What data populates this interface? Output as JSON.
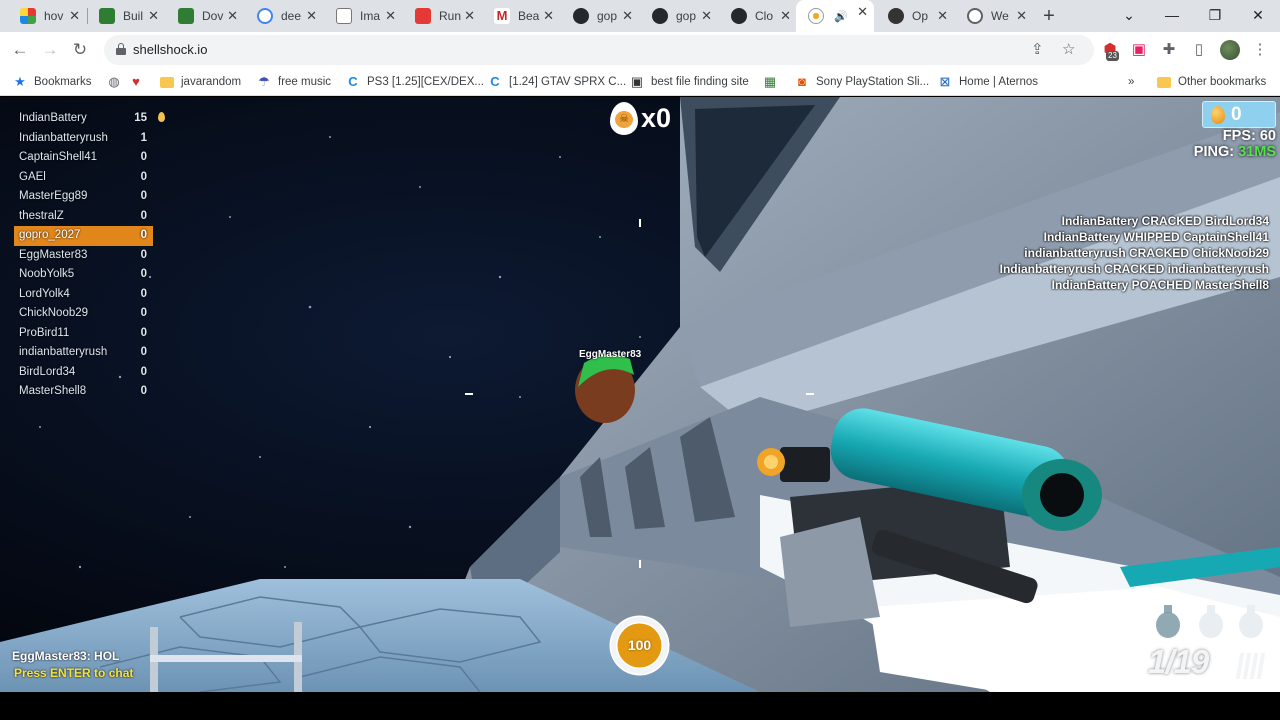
{
  "browser": {
    "tabs": [
      {
        "label": "hov",
        "active": false
      },
      {
        "label": "Buil",
        "active": false
      },
      {
        "label": "Dov",
        "active": false
      },
      {
        "label": "dee",
        "active": false
      },
      {
        "label": "Ima",
        "active": false
      },
      {
        "label": "Run",
        "active": false
      },
      {
        "label": "Bea",
        "active": false
      },
      {
        "label": "gop",
        "active": false
      },
      {
        "label": "gop",
        "active": false
      },
      {
        "label": "Clo",
        "active": false
      },
      {
        "label": "",
        "active": true
      },
      {
        "label": "Op",
        "active": false
      },
      {
        "label": "We",
        "active": false
      }
    ],
    "new_tab_icon": "+",
    "url": "shellshock.io",
    "extension_badge": "23",
    "bookmarks": [
      {
        "label": "Bookmarks",
        "icon": "star-icon"
      },
      {
        "label": "",
        "icon": "globe-icon"
      },
      {
        "label": "",
        "icon": "heart-icon"
      },
      {
        "label": "javarandom",
        "icon": "folder-icon"
      },
      {
        "label": "free music",
        "icon": "parachute-icon"
      },
      {
        "label": "PS3 [1.25][CEX/DEX...",
        "icon": "c-logo-icon"
      },
      {
        "label": "[1.24] GTAV SPRX C...",
        "icon": "c-logo-icon"
      },
      {
        "label": "best file finding site",
        "icon": "robot-icon"
      },
      {
        "label": "",
        "icon": "game-icon"
      },
      {
        "label": "Sony PlayStation Sli...",
        "icon": "bag-icon"
      },
      {
        "label": "Home | Aternos",
        "icon": "aternos-icon"
      }
    ],
    "other_bookmarks": "Other bookmarks",
    "overflow": "»"
  },
  "game": {
    "leaderboard": [
      {
        "name": "IndianBattery",
        "score": "15",
        "self": false,
        "egg": true
      },
      {
        "name": "Indianbatteryrush",
        "score": "1",
        "self": false
      },
      {
        "name": "CaptainShell41",
        "score": "0",
        "self": false
      },
      {
        "name": "GAEl",
        "score": "0",
        "self": false
      },
      {
        "name": "MasterEgg89",
        "score": "0",
        "self": false
      },
      {
        "name": "thestralZ",
        "score": "0",
        "self": false
      },
      {
        "name": "gopro_2027",
        "score": "0",
        "self": true
      },
      {
        "name": "EggMaster83",
        "score": "0",
        "self": false
      },
      {
        "name": "NoobYolk5",
        "score": "0",
        "self": false
      },
      {
        "name": "LordYolk4",
        "score": "0",
        "self": false
      },
      {
        "name": "ChickNoob29",
        "score": "0",
        "self": false
      },
      {
        "name": "ProBird11",
        "score": "0",
        "self": false
      },
      {
        "name": "indianbatteryrush",
        "score": "0",
        "self": false
      },
      {
        "name": "BirdLord34",
        "score": "0",
        "self": false
      },
      {
        "name": "MasterShell8",
        "score": "0",
        "self": false
      }
    ],
    "streak": "x0",
    "eggs": "0",
    "fps_label": "FPS:",
    "fps": "60",
    "ping_label": "PING:",
    "ping": "31MS",
    "killfeed": [
      "IndianBattery CRACKED BirdLord34",
      "IndianBattery WHIPPED CaptainShell41",
      "indianbatteryrush CRACKED ChickNoob29",
      "Indianbatteryrush CRACKED indianbatteryrush",
      "IndianBattery POACHED MasterShell8"
    ],
    "enemy_nametag": "EggMaster83",
    "chat_message": "EggMaster83: HOL",
    "chat_hint": "Press ENTER to chat",
    "health": "100",
    "health_fraction": 1.0,
    "ammo": "1/19",
    "grenades": 3
  },
  "colors": {
    "self_highlight": "#e0861b",
    "ping_good": "#54e24a",
    "chat_hint": "#f7e33a",
    "weapon_teal": "#1ab0b8"
  }
}
